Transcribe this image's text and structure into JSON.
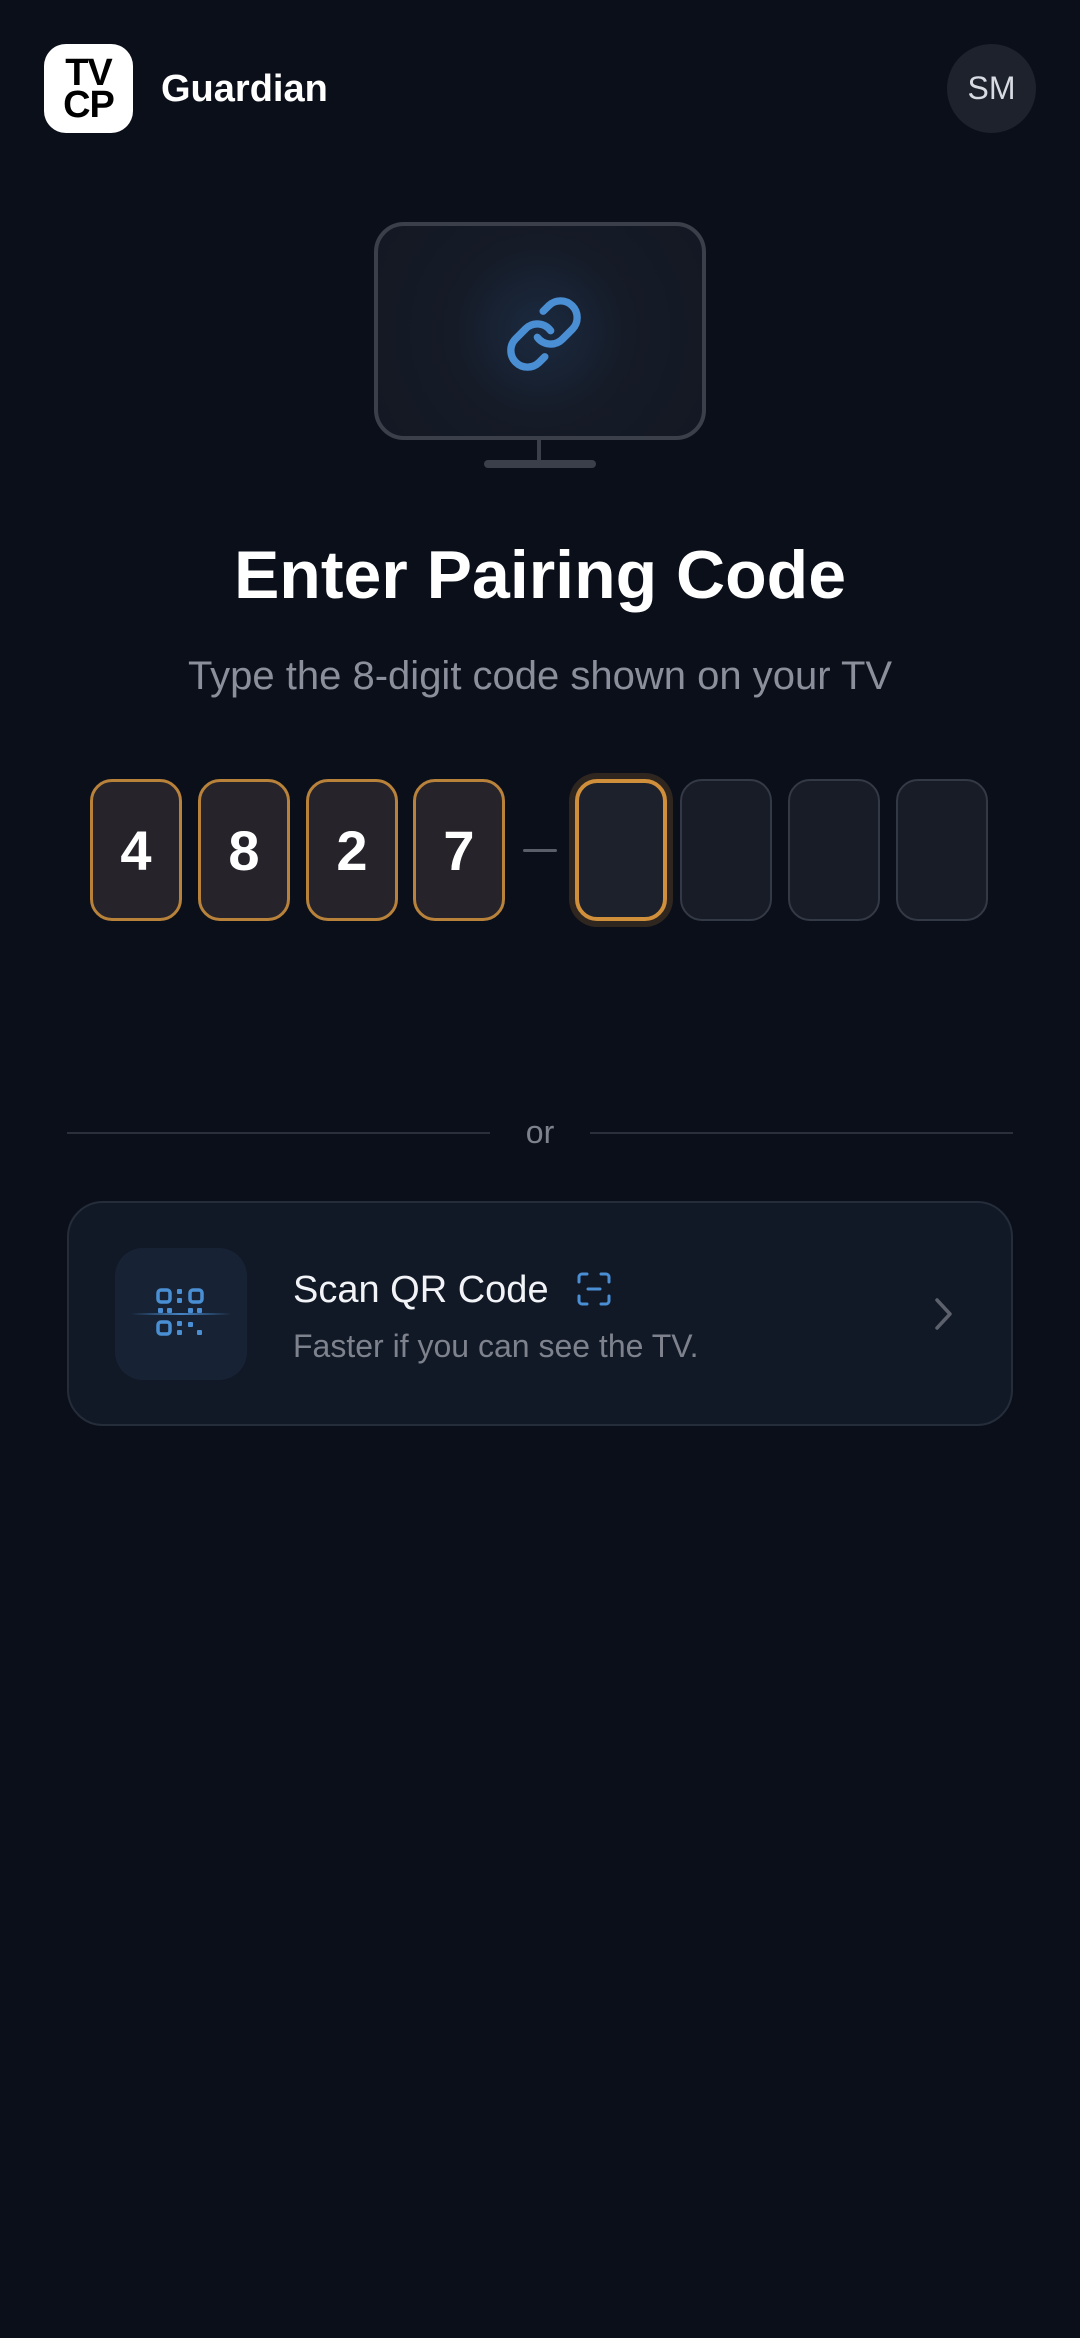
{
  "header": {
    "logo_line1": "TV",
    "logo_line2": "CP",
    "app_name": "Guardian",
    "avatar_initials": "SM"
  },
  "illustration": {
    "icon": "link-icon",
    "accent_color": "#4a8fd4"
  },
  "pairing": {
    "title": "Enter Pairing Code",
    "subtitle": "Type the 8-digit code shown on your TV",
    "digits": [
      "4",
      "8",
      "2",
      "7",
      "",
      "",
      "",
      ""
    ],
    "active_index": 4,
    "filled_border_color": "#b8823a"
  },
  "divider": {
    "label": "or"
  },
  "qr_option": {
    "title": "Scan QR Code",
    "subtitle": "Faster if you can see the TV.",
    "icon": "qr-code-icon",
    "title_icon": "scan-icon",
    "action_icon": "chevron-right-icon"
  }
}
